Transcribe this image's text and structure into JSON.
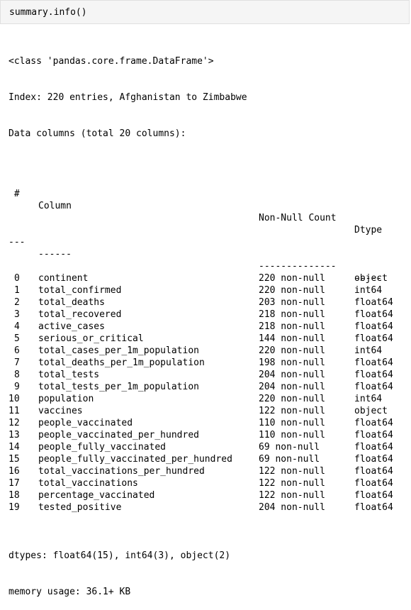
{
  "input": {
    "code": "summary.info()"
  },
  "output": {
    "class_line": "<class 'pandas.core.frame.DataFrame'>",
    "index_line": "Index: 220 entries, Afghanistan to Zimbabwe",
    "data_columns_line": "Data columns (total 20 columns):",
    "header": {
      "idx": " #",
      "column": "Column",
      "nonnull": "Non-Null Count",
      "dtype": "Dtype"
    },
    "separator": {
      "idx": "---",
      "column": "------",
      "nonnull": "--------------",
      "dtype": "-----"
    },
    "rows": [
      {
        "idx": "0",
        "column": "continent",
        "nonnull": "220 non-null",
        "dtype": "object"
      },
      {
        "idx": "1",
        "column": "total_confirmed",
        "nonnull": "220 non-null",
        "dtype": "int64"
      },
      {
        "idx": "2",
        "column": "total_deaths",
        "nonnull": "203 non-null",
        "dtype": "float64"
      },
      {
        "idx": "3",
        "column": "total_recovered",
        "nonnull": "218 non-null",
        "dtype": "float64"
      },
      {
        "idx": "4",
        "column": "active_cases",
        "nonnull": "218 non-null",
        "dtype": "float64"
      },
      {
        "idx": "5",
        "column": "serious_or_critical",
        "nonnull": "144 non-null",
        "dtype": "float64"
      },
      {
        "idx": "6",
        "column": "total_cases_per_1m_population",
        "nonnull": "220 non-null",
        "dtype": "int64"
      },
      {
        "idx": "7",
        "column": "total_deaths_per_1m_population",
        "nonnull": "198 non-null",
        "dtype": "float64"
      },
      {
        "idx": "8",
        "column": "total_tests",
        "nonnull": "204 non-null",
        "dtype": "float64"
      },
      {
        "idx": "9",
        "column": "total_tests_per_1m_population",
        "nonnull": "204 non-null",
        "dtype": "float64"
      },
      {
        "idx": "10",
        "column": "population",
        "nonnull": "220 non-null",
        "dtype": "int64"
      },
      {
        "idx": "11",
        "column": "vaccines",
        "nonnull": "122 non-null",
        "dtype": "object"
      },
      {
        "idx": "12",
        "column": "people_vaccinated",
        "nonnull": "110 non-null",
        "dtype": "float64"
      },
      {
        "idx": "13",
        "column": "people_vaccinated_per_hundred",
        "nonnull": "110 non-null",
        "dtype": "float64"
      },
      {
        "idx": "14",
        "column": "people_fully_vaccinated",
        "nonnull": "69 non-null",
        "dtype": "float64"
      },
      {
        "idx": "15",
        "column": "people_fully_vaccinated_per_hundred",
        "nonnull": "69 non-null",
        "dtype": "float64"
      },
      {
        "idx": "16",
        "column": "total_vaccinations_per_hundred",
        "nonnull": "122 non-null",
        "dtype": "float64"
      },
      {
        "idx": "17",
        "column": "total_vaccinations",
        "nonnull": "122 non-null",
        "dtype": "float64"
      },
      {
        "idx": "18",
        "column": "percentage_vaccinated",
        "nonnull": "122 non-null",
        "dtype": "float64"
      },
      {
        "idx": "19",
        "column": "tested_positive",
        "nonnull": "204 non-null",
        "dtype": "float64"
      }
    ],
    "dtypes_line": "dtypes: float64(15), int64(3), object(2)",
    "memory_line": "memory usage: 36.1+ KB"
  }
}
